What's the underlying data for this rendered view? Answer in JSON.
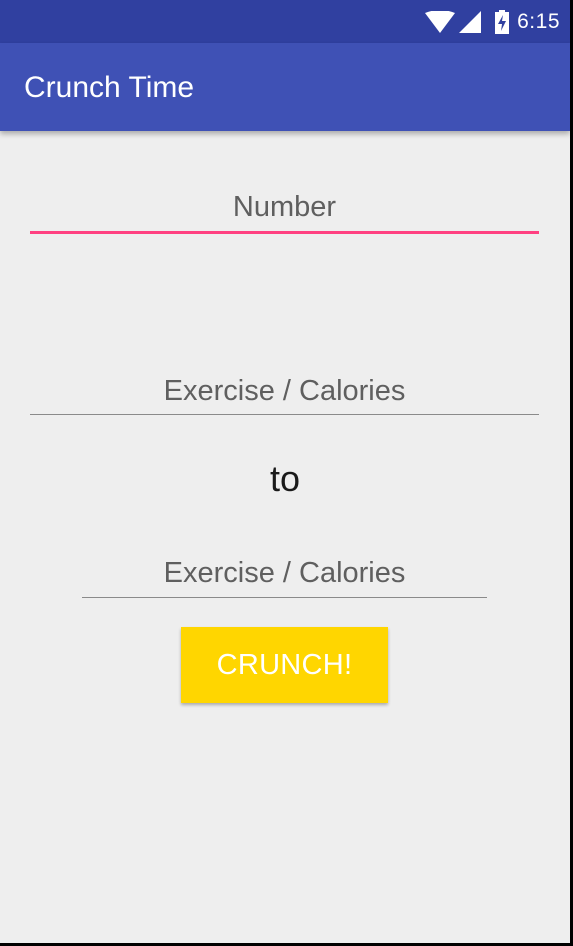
{
  "status_bar": {
    "time": "6:15",
    "icons": [
      "wifi-icon",
      "cellular-signal-icon",
      "battery-charging-icon"
    ]
  },
  "app_bar": {
    "title": "Crunch Time"
  },
  "form": {
    "number_placeholder": "Number",
    "exercise_from_placeholder": "Exercise / Calories",
    "to_label": "to",
    "exercise_to_placeholder": "Exercise / Calories",
    "crunch_button_label": "CRUNCH!"
  },
  "colors": {
    "status_bar": "#3040a0",
    "app_bar": "#3f51b5",
    "accent": "#ff4081",
    "button": "#ffd600",
    "background": "#eeeeee"
  }
}
